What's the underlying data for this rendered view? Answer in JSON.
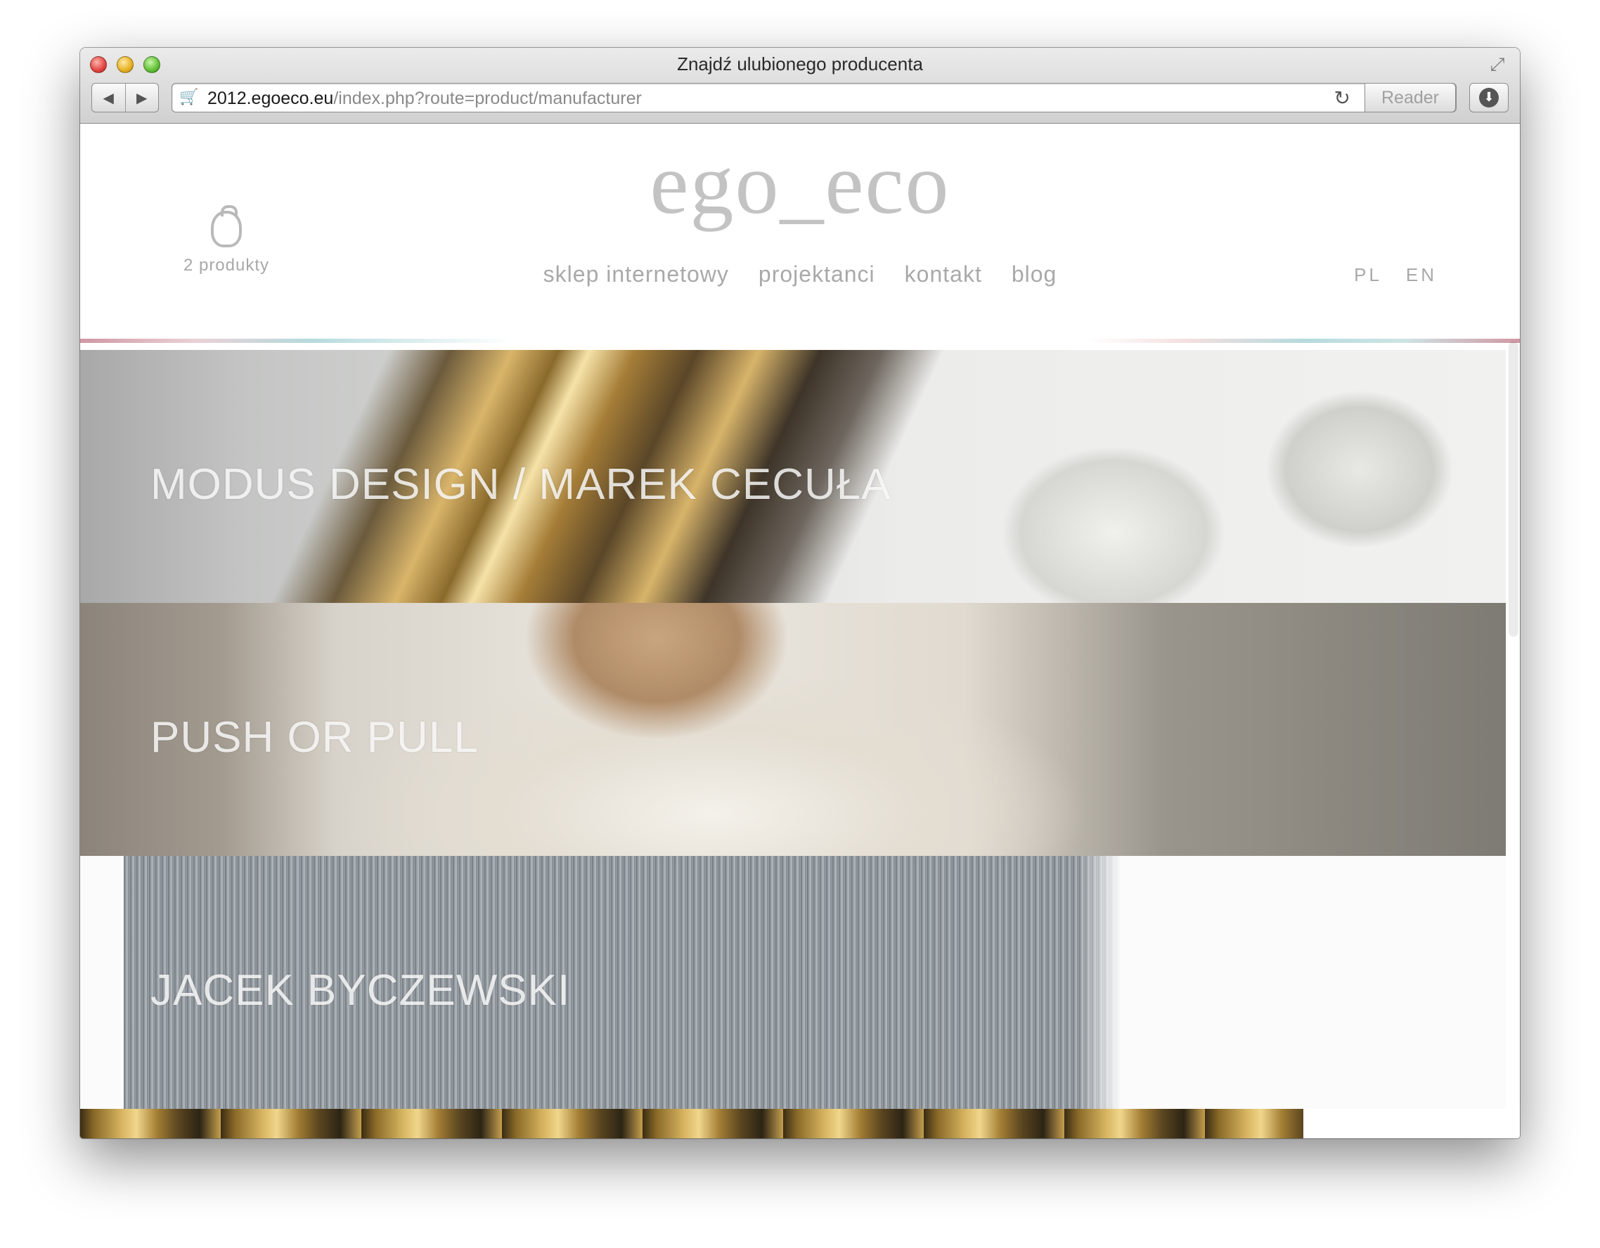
{
  "browser": {
    "window_title": "Znajdź ulubionego producenta",
    "url_host": "2012.egoeco.eu",
    "url_path": "/index.php?route=product/manufacturer",
    "reader_label": "Reader",
    "back_icon": "back-arrow-icon",
    "forward_icon": "forward-arrow-icon"
  },
  "site": {
    "logo": "ego_eco",
    "cart_label": "2 produkty",
    "nav": [
      "sklep internetowy",
      "projektanci",
      "kontakt",
      "blog"
    ],
    "languages": [
      "PL",
      "EN"
    ]
  },
  "manufacturers": [
    {
      "name": "MODUS DESIGN / MAREK CECUŁA"
    },
    {
      "name": "PUSH OR PULL"
    },
    {
      "name": "JACEK BYCZEWSKI"
    },
    {
      "name": ""
    }
  ],
  "colors": {
    "logo": "#c3c3c3",
    "nav_text": "#a9a9a9",
    "accent_pink": "#c88592",
    "accent_teal": "#a9d4d7"
  }
}
